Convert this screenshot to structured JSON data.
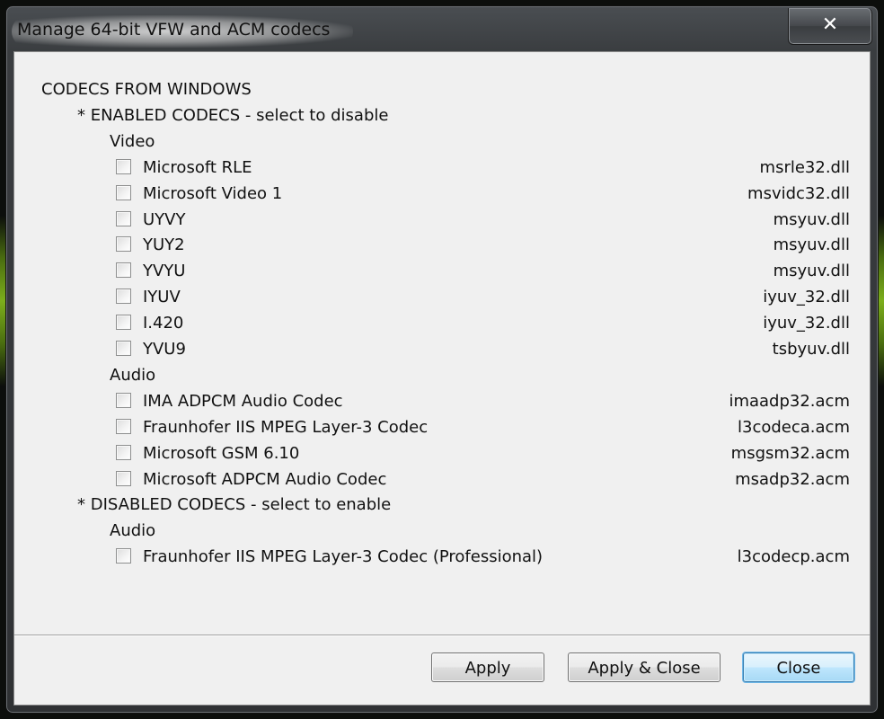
{
  "window": {
    "title": "Manage 64-bit VFW and ACM codecs",
    "close_glyph": "✕"
  },
  "codecs": {
    "header": "CODECS FROM WINDOWS",
    "enabled": {
      "label": "* ENABLED CODECS  -  select to disable",
      "video_label": "Video",
      "video": [
        {
          "name": "Microsoft RLE",
          "file": "msrle32.dll",
          "checked": false
        },
        {
          "name": "Microsoft Video 1",
          "file": "msvidc32.dll",
          "checked": false
        },
        {
          "name": "UYVY",
          "file": "msyuv.dll",
          "checked": false
        },
        {
          "name": "YUY2",
          "file": "msyuv.dll",
          "checked": false
        },
        {
          "name": "YVYU",
          "file": "msyuv.dll",
          "checked": false
        },
        {
          "name": "IYUV",
          "file": "iyuv_32.dll",
          "checked": false
        },
        {
          "name": "I.420",
          "file": "iyuv_32.dll",
          "checked": false
        },
        {
          "name": "YVU9",
          "file": "tsbyuv.dll",
          "checked": false
        }
      ],
      "audio_label": "Audio",
      "audio": [
        {
          "name": "IMA ADPCM Audio Codec",
          "file": "imaadp32.acm",
          "checked": false
        },
        {
          "name": "Fraunhofer IIS MPEG Layer-3 Codec",
          "file": "l3codeca.acm",
          "checked": false
        },
        {
          "name": "Microsoft GSM 6.10",
          "file": "msgsm32.acm",
          "checked": false
        },
        {
          "name": "Microsoft ADPCM Audio Codec",
          "file": "msadp32.acm",
          "checked": false
        }
      ]
    },
    "disabled": {
      "label": "* DISABLED CODECS  -  select to enable",
      "audio_label": "Audio",
      "audio": [
        {
          "name": "Fraunhofer IIS MPEG Layer-3 Codec (Professional)",
          "file": "l3codecp.acm",
          "checked": false
        }
      ]
    }
  },
  "buttons": {
    "apply": "Apply",
    "apply_close": "Apply & Close",
    "close": "Close"
  }
}
